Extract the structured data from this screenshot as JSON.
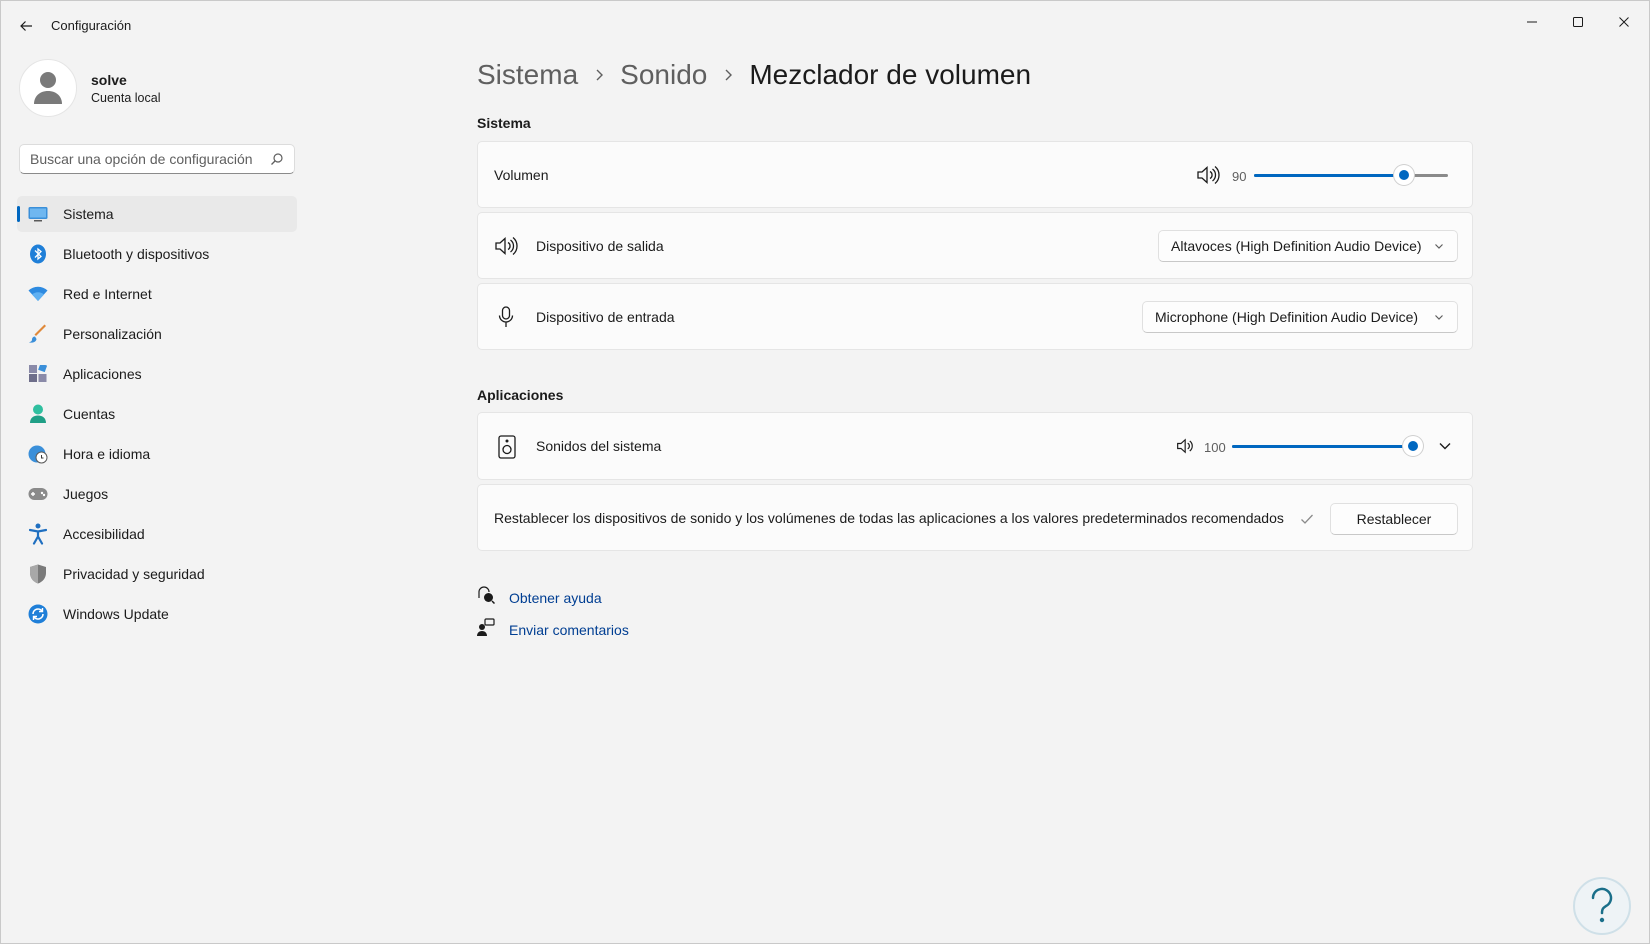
{
  "window": {
    "title": "Configuración",
    "icons": {
      "back": "back-arrow-icon",
      "minimize": "minimize-icon",
      "maximize": "maximize-icon",
      "close": "close-icon"
    }
  },
  "profile": {
    "name": "solve",
    "account_type": "Cuenta local"
  },
  "search": {
    "placeholder": "Buscar una opción de configuración"
  },
  "sidebar": {
    "items": [
      {
        "label": "Sistema",
        "icon": "system-display-icon",
        "active": true
      },
      {
        "label": "Bluetooth y dispositivos",
        "icon": "bluetooth-icon"
      },
      {
        "label": "Red e Internet",
        "icon": "wifi-icon"
      },
      {
        "label": "Personalización",
        "icon": "brush-icon"
      },
      {
        "label": "Aplicaciones",
        "icon": "apps-icon"
      },
      {
        "label": "Cuentas",
        "icon": "person-icon"
      },
      {
        "label": "Hora e idioma",
        "icon": "globe-clock-icon"
      },
      {
        "label": "Juegos",
        "icon": "gamepad-icon"
      },
      {
        "label": "Accesibilidad",
        "icon": "accessibility-icon"
      },
      {
        "label": "Privacidad y seguridad",
        "icon": "shield-icon"
      },
      {
        "label": "Windows Update",
        "icon": "update-icon"
      }
    ]
  },
  "breadcrumb": {
    "items": [
      "Sistema",
      "Sonido",
      "Mezclador de volumen"
    ]
  },
  "system_section": {
    "title": "Sistema",
    "volume": {
      "label": "Volumen",
      "value": "90",
      "level": 90
    },
    "output": {
      "label": "Dispositivo de salida",
      "selected": "Altavoces (High Definition Audio Device)"
    },
    "input": {
      "label": "Dispositivo de entrada",
      "selected": "Microphone (High Definition Audio Device)"
    }
  },
  "apps_section": {
    "title": "Aplicaciones",
    "system_sounds": {
      "label": "Sonidos del sistema",
      "value": "100",
      "level": 100
    },
    "reset": {
      "text": "Restablecer los dispositivos de sonido y los volúmenes de todas las aplicaciones a los valores predeterminados recomendados",
      "button": "Restablecer"
    }
  },
  "links": {
    "help": "Obtener ayuda",
    "feedback": "Enviar comentarios"
  },
  "colors": {
    "accent": "#0067c0",
    "link": "#003e92",
    "background": "#f3f3f3",
    "card": "#fbfbfb"
  }
}
